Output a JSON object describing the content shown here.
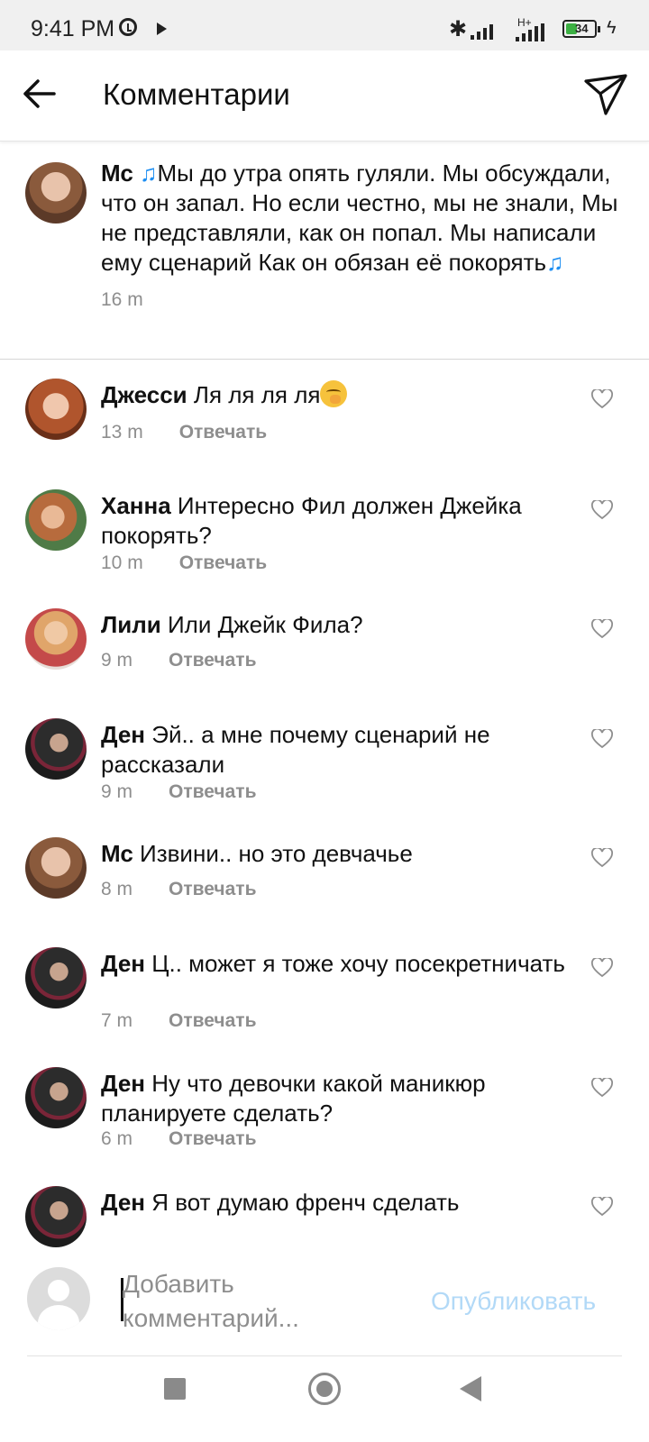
{
  "status_bar": {
    "time": "9:41 PM",
    "network": "H+",
    "battery": "34"
  },
  "header": {
    "title": "Комментарии"
  },
  "caption": {
    "author": "Мс",
    "text_1": "Мы до утра опять гуляли. Мы обсуждали, что он запал. Но если честно, мы не знали, Мы не представляли, как он попал. Мы написали ему сценарий Как он обязан её покорять",
    "time": "16 m"
  },
  "reply_label": "Отвечать",
  "comments": [
    {
      "author": "Джесси",
      "text": "Ля ля ля ля",
      "time": "13 m"
    },
    {
      "author": "Ханна",
      "text": "Интересно Фил должен Джейка покорять?",
      "time": "10 m"
    },
    {
      "author": "Лили",
      "text": "Или Джейк Фила?",
      "time": "9 m"
    },
    {
      "author": "Ден",
      "text": "Эй.. а мне почему сценарий не рассказали",
      "time": "9 m"
    },
    {
      "author": "Мс",
      "text": "Извини.. но это девчачье",
      "time": "8 m"
    },
    {
      "author": "Ден",
      "text": "Ц.. может я тоже хочу посекретничать",
      "time": "7 m"
    },
    {
      "author": "Ден",
      "text": "Ну что девочки какой маникюр планируете сделать?",
      "time": "6 m"
    },
    {
      "author": "Ден",
      "text": "Я вот думаю френч сделать",
      "time": ""
    }
  ],
  "composer": {
    "placeholder": "Добавить комментарий...",
    "publish_label": "Опубликовать"
  },
  "colors": {
    "accent_disabled": "#b2d9f7",
    "music_note": "#1d8ef2",
    "secondary_text": "#8e8e8e"
  }
}
